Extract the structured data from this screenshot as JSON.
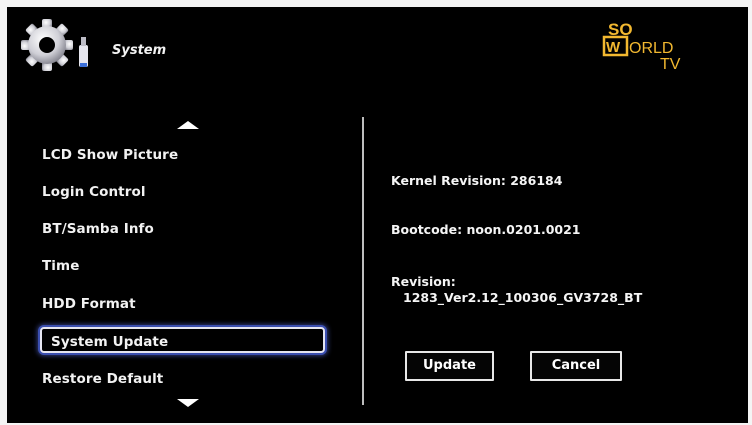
{
  "header": {
    "title": "System",
    "icon": "gear-usb-icon",
    "brand": {
      "line1": "SO",
      "boxed_letter": "W",
      "line2_rest": "ORLD",
      "line3": "TV"
    }
  },
  "menu": {
    "items": [
      {
        "label": "LCD Show Picture",
        "selected": false
      },
      {
        "label": "Login Control",
        "selected": false
      },
      {
        "label": "BT/Samba Info",
        "selected": false
      },
      {
        "label": "Time",
        "selected": false
      },
      {
        "label": "HDD Format",
        "selected": false
      },
      {
        "label": "System Update",
        "selected": true
      },
      {
        "label": "Restore Default",
        "selected": false
      }
    ],
    "scroll_up_icon": "triangle-up-icon",
    "scroll_down_icon": "triangle-down-icon"
  },
  "info": {
    "kernel": "Kernel Revision: 286184",
    "bootcode": "Bootcode: noon.0201.0021",
    "revision_label": "Revision:",
    "revision_value": "1283_Ver2.12_100306_GV3728_BT"
  },
  "buttons": {
    "update": "Update",
    "cancel": "Cancel"
  },
  "colors": {
    "background": "#000000",
    "text": "#ffffff",
    "selection_glow": "#3b4fb0",
    "brand": "#f2b830"
  }
}
